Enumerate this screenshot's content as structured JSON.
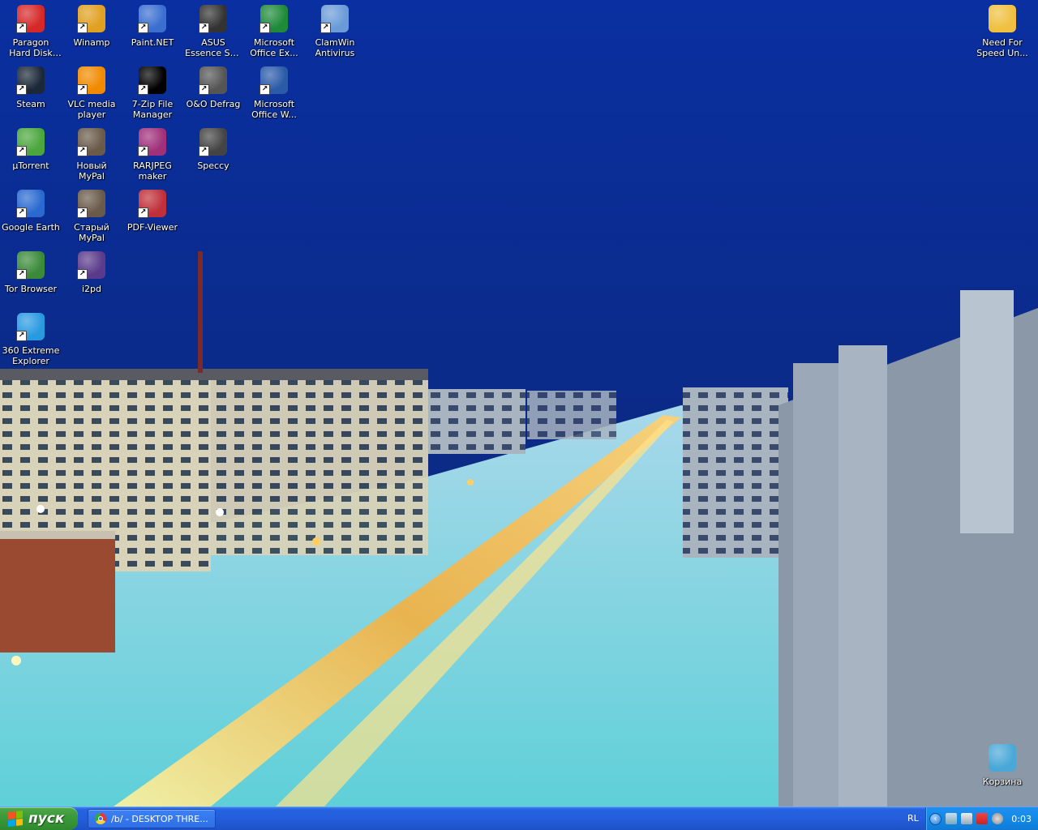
{
  "desktop": {
    "icons": [
      {
        "label": "Paragon Hard Disk Manag...",
        "icon": "paragon-icon",
        "color": "#d62828"
      },
      {
        "label": "Winamp",
        "icon": "winamp-icon",
        "color": "#e0a020"
      },
      {
        "label": "Paint.NET",
        "icon": "paintnet-icon",
        "color": "#3a6fd0"
      },
      {
        "label": "ASUS Essence STX II",
        "icon": "asus-audio-icon",
        "color": "#333333"
      },
      {
        "label": "Microsoft Office Ex...",
        "icon": "excel-icon",
        "color": "#1f8a3a"
      },
      {
        "label": "ClamWin Antivirus",
        "icon": "clamwin-icon",
        "color": "#6a9bd8"
      },
      {
        "label": "Steam",
        "icon": "steam-icon",
        "color": "#1b2838"
      },
      {
        "label": "VLC media player",
        "icon": "vlc-icon",
        "color": "#f08a00"
      },
      {
        "label": "7-Zip File Manager",
        "icon": "7zip-icon",
        "color": "#000000"
      },
      {
        "label": "O&O Defrag",
        "icon": "oo-defrag-icon",
        "color": "#555555"
      },
      {
        "label": "Microsoft Office W...",
        "icon": "word-icon",
        "color": "#2b5aa8"
      },
      {
        "label": "µTorrent",
        "icon": "utorrent-icon",
        "color": "#4ba63d"
      },
      {
        "label": "Новый MyPal",
        "icon": "mypal-icon",
        "color": "#6a5a4a"
      },
      {
        "label": "RARJPEG maker",
        "icon": "rarjpeg-icon",
        "color": "#a0307a"
      },
      {
        "label": "Speccy",
        "icon": "speccy-icon",
        "color": "#444444"
      },
      {
        "label": "Google Earth",
        "icon": "google-earth-icon",
        "color": "#2a6ad0"
      },
      {
        "label": "Старый MyPal",
        "icon": "mypal-old-icon",
        "color": "#6a5a4a"
      },
      {
        "label": "PDF-Viewer",
        "icon": "pdf-icon",
        "color": "#c0303a"
      },
      {
        "label": "Tor Browser",
        "icon": "tor-icon",
        "color": "#3a8a3a"
      },
      {
        "label": "i2pd",
        "icon": "i2pd-icon",
        "color": "#5a3a8a"
      },
      {
        "label": "360 Extreme Explorer",
        "icon": "360-browser-icon",
        "color": "#2a9ae0"
      },
      {
        "label": "Need For Speed Un...",
        "icon": "folder-icon",
        "color": "#f0c040"
      },
      {
        "label": "Корзина",
        "icon": "recycle-bin-icon",
        "color": "#4aa8d8"
      }
    ]
  },
  "taskbar": {
    "start_label": "пуск",
    "window_button": "/b/ - DESKTOP THRE...",
    "language": "RL",
    "tray_chevron": "‹",
    "clock": "0:03"
  },
  "colors": {
    "sky": "#0b2f8f",
    "taskbar": "#245edb",
    "start": "#3c9a3a",
    "tray": "#128ae8"
  }
}
